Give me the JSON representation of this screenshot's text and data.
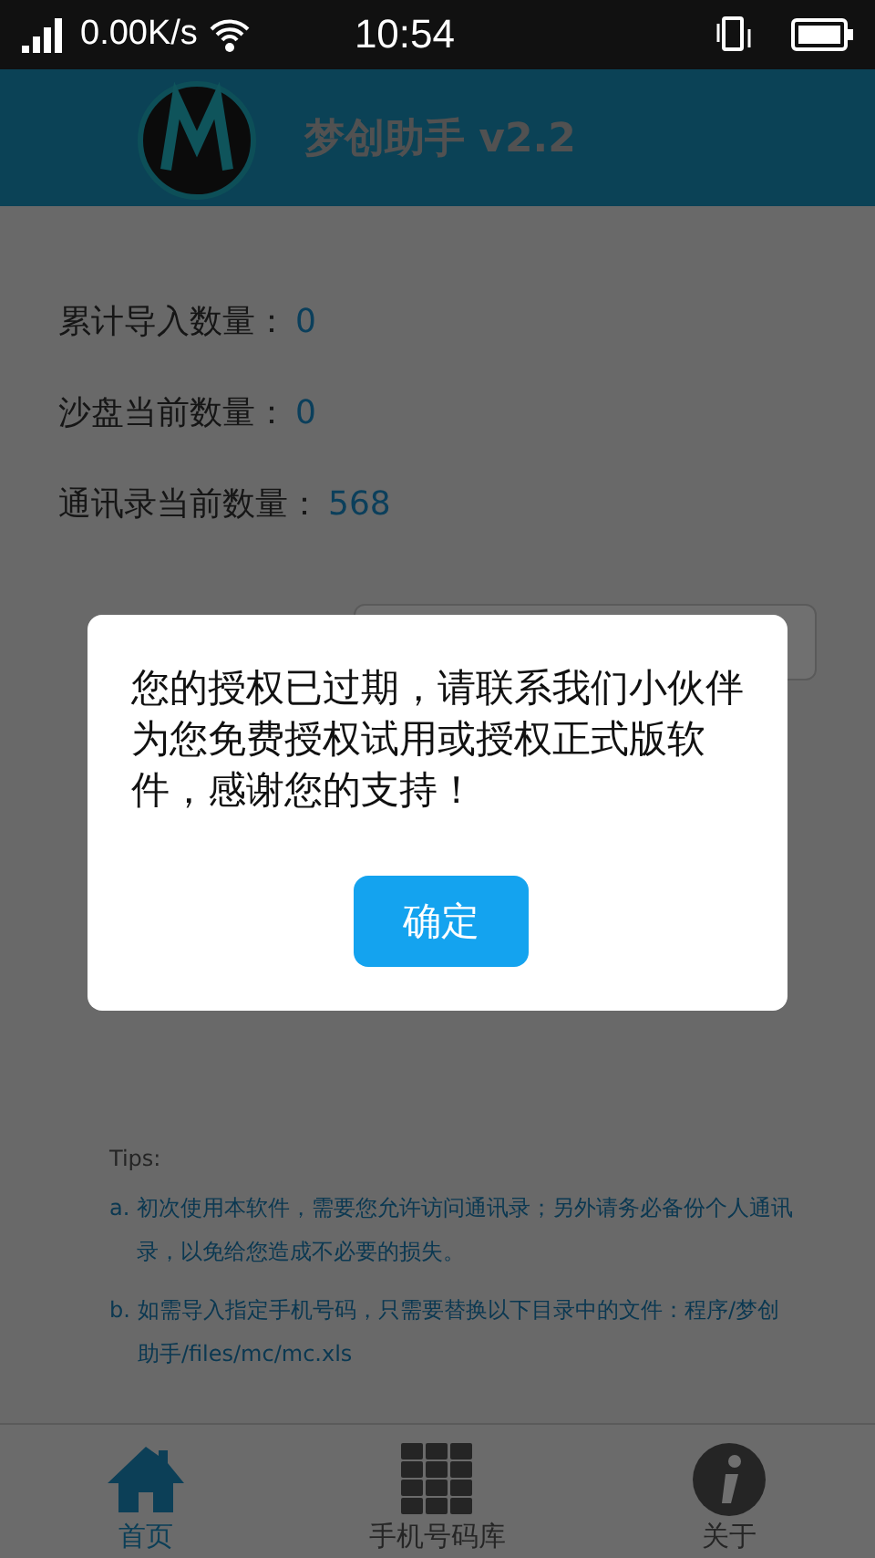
{
  "status_bar": {
    "speed": "0.00K/s",
    "time": "10:54"
  },
  "header": {
    "title": "梦创助手 v2.2"
  },
  "stats": [
    {
      "label": "累计导入数量：",
      "value": "0"
    },
    {
      "label": "沙盘当前数量：",
      "value": "0"
    },
    {
      "label": "通讯录当前数量：",
      "value": "568"
    }
  ],
  "tips": {
    "title": "Tips:",
    "items": [
      {
        "marker": "a.",
        "text": "初次使用本软件，需要您允许访问通讯录；另外请务必备份个人通讯录，以免给您造成不必要的损失。"
      },
      {
        "marker": "b.",
        "text": "如需导入指定手机号码，只需要替换以下目录中的文件：程序/梦创助手/files/mc/mc.xls"
      }
    ]
  },
  "tab_bar": [
    {
      "label": "首页",
      "kind": "home",
      "selected": true
    },
    {
      "label": "手机号码库",
      "kind": "grid",
      "selected": false
    },
    {
      "label": "关于",
      "kind": "info",
      "selected": false
    }
  ],
  "dialog": {
    "message": "您的授权已过期，请联系我们小伙伴为您免费授权试用或授权正式版软件，感谢您的支持！",
    "button": "确定"
  }
}
